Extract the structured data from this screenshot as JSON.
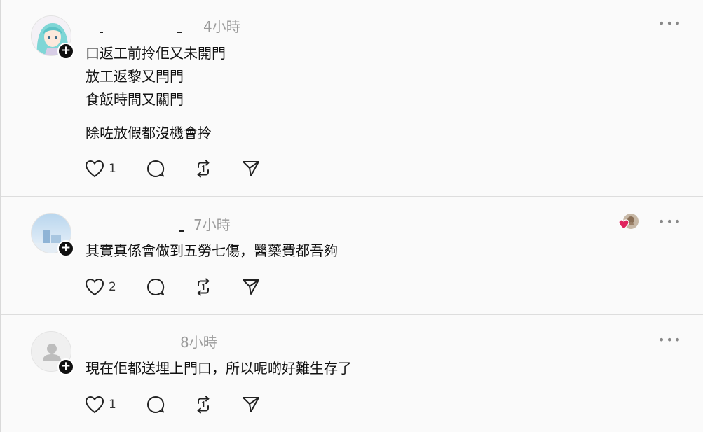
{
  "colors": {
    "background": "#fafafa",
    "text": "#111111",
    "muted": "#9a9a9a",
    "heart_accent": "#e0245e"
  },
  "comments": [
    {
      "time": "4小時",
      "lines": [
        "口返工前拎佢又未開門",
        "放工返黎又閂門",
        "食飯時間又關門",
        "除咗放假都沒機會拎"
      ],
      "likes": "1",
      "avatar": "anime-character-avatar"
    },
    {
      "time": "7小時",
      "lines": [
        "其實真係會做到五勞七傷，醫藥費都吾夠"
      ],
      "likes": "2",
      "avatar": "landscape-avatar"
    },
    {
      "time": "8小時",
      "lines": [
        "現在佢都送埋上門口，所以呢啲好難生存了"
      ],
      "likes": "1",
      "avatar": "default-user-avatar"
    }
  ],
  "icons": {
    "like": "heart-icon",
    "reply": "comment-icon",
    "repost": "repost-icon",
    "share": "send-icon",
    "more": "more-dots-icon",
    "follow": "plus-icon"
  },
  "more_label": "•••",
  "follow_label": "+"
}
